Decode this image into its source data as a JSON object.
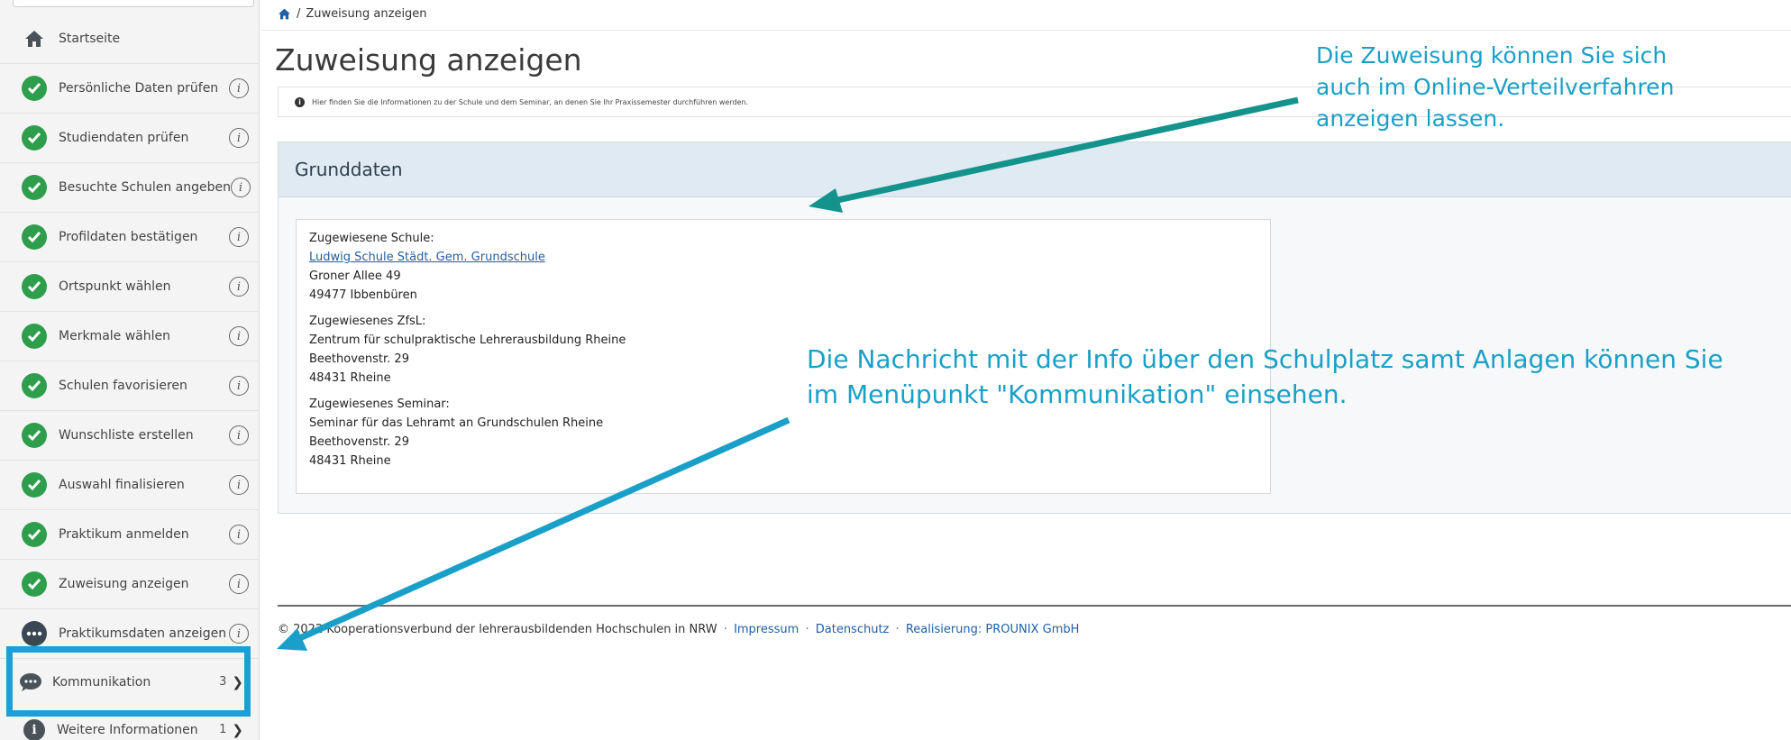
{
  "breadcrumb": {
    "separator": "/",
    "current": "Zuweisung anzeigen"
  },
  "page": {
    "title": "Zuweisung anzeigen",
    "notice": "Hier finden Sie die Informationen zu der Schule und dem Seminar, an denen Sie Ihr Praxissemester durchführen werden.",
    "notice_icon": "i"
  },
  "sidebar": {
    "items": [
      {
        "label": "Startseite",
        "icon": "home-icon",
        "status": "none"
      },
      {
        "label": "Persönliche Daten prüfen",
        "icon": "check-circle-icon",
        "info": "i"
      },
      {
        "label": "Studiendaten prüfen",
        "icon": "check-circle-icon",
        "info": "i"
      },
      {
        "label": "Besuchte Schulen angeben",
        "icon": "check-circle-icon",
        "info": "i"
      },
      {
        "label": "Profildaten bestätigen",
        "icon": "check-circle-icon",
        "info": "i"
      },
      {
        "label": "Ortspunkt wählen",
        "icon": "check-circle-icon",
        "info": "i"
      },
      {
        "label": "Merkmale wählen",
        "icon": "check-circle-icon",
        "info": "i"
      },
      {
        "label": "Schulen favorisieren",
        "icon": "check-circle-icon",
        "info": "i"
      },
      {
        "label": "Wunschliste erstellen",
        "icon": "check-circle-icon",
        "info": "i"
      },
      {
        "label": "Auswahl finalisieren",
        "icon": "check-circle-icon",
        "info": "i"
      },
      {
        "label": "Praktikum anmelden",
        "icon": "check-circle-icon",
        "info": "i"
      },
      {
        "label": "Zuweisung anzeigen",
        "icon": "check-circle-icon",
        "info": "i"
      },
      {
        "label": "Praktikumsdaten anzeigen",
        "icon": "ellipsis-circle-icon",
        "info": "i"
      },
      {
        "label": "Kommunikation",
        "icon": "speech-bubble-icon",
        "count": "3"
      },
      {
        "label": "Weitere Informationen",
        "icon": "info-circle-icon",
        "count": "1"
      }
    ]
  },
  "grunddaten": {
    "heading": "Grunddaten",
    "schule_label": "Zugewiesene Schule:",
    "schule_name": "Ludwig Schule Städt. Gem. Grundschule",
    "schule_street": "Groner Allee 49",
    "schule_city": "49477 Ibbenbüren",
    "zfsl_label": "Zugewiesenes ZfsL:",
    "zfsl_name": "Zentrum für schulpraktische Lehrerausbildung Rheine",
    "zfsl_street": "Beethovenstr. 29",
    "zfsl_city": "48431 Rheine",
    "seminar_label": "Zugewiesenes Seminar:",
    "seminar_name": "Seminar für das Lehramt an Grundschulen Rheine",
    "seminar_street": "Beethovenstr. 29",
    "seminar_city": "48431 Rheine"
  },
  "footer": {
    "copyright": "© 2022 Kooperationsverbund der lehrerausbildenden Hochschulen in NRW",
    "impressum": "Impressum",
    "datenschutz": "Datenschutz",
    "realisierung": "Realisierung: PROUNIX GmbH",
    "sep": "·"
  },
  "callouts": {
    "top": "Die Zuweisung können Sie sich auch im Online-Verteilverfahren anzeigen lassen.",
    "middle_line1": "Die Nachricht mit der Info über den Schulplatz samt Anlagen können Sie",
    "middle_line2": "im Menüpunkt \"Kommunikation\" einsehen."
  },
  "colors": {
    "check_green": "#2e9e4d",
    "callout_blue": "#1aa0c8",
    "arrow_teal": "#14938c",
    "highlight_blue": "#1aa0d8",
    "link_blue": "#1d5fa8",
    "panel_head": "#dfeaf2"
  }
}
